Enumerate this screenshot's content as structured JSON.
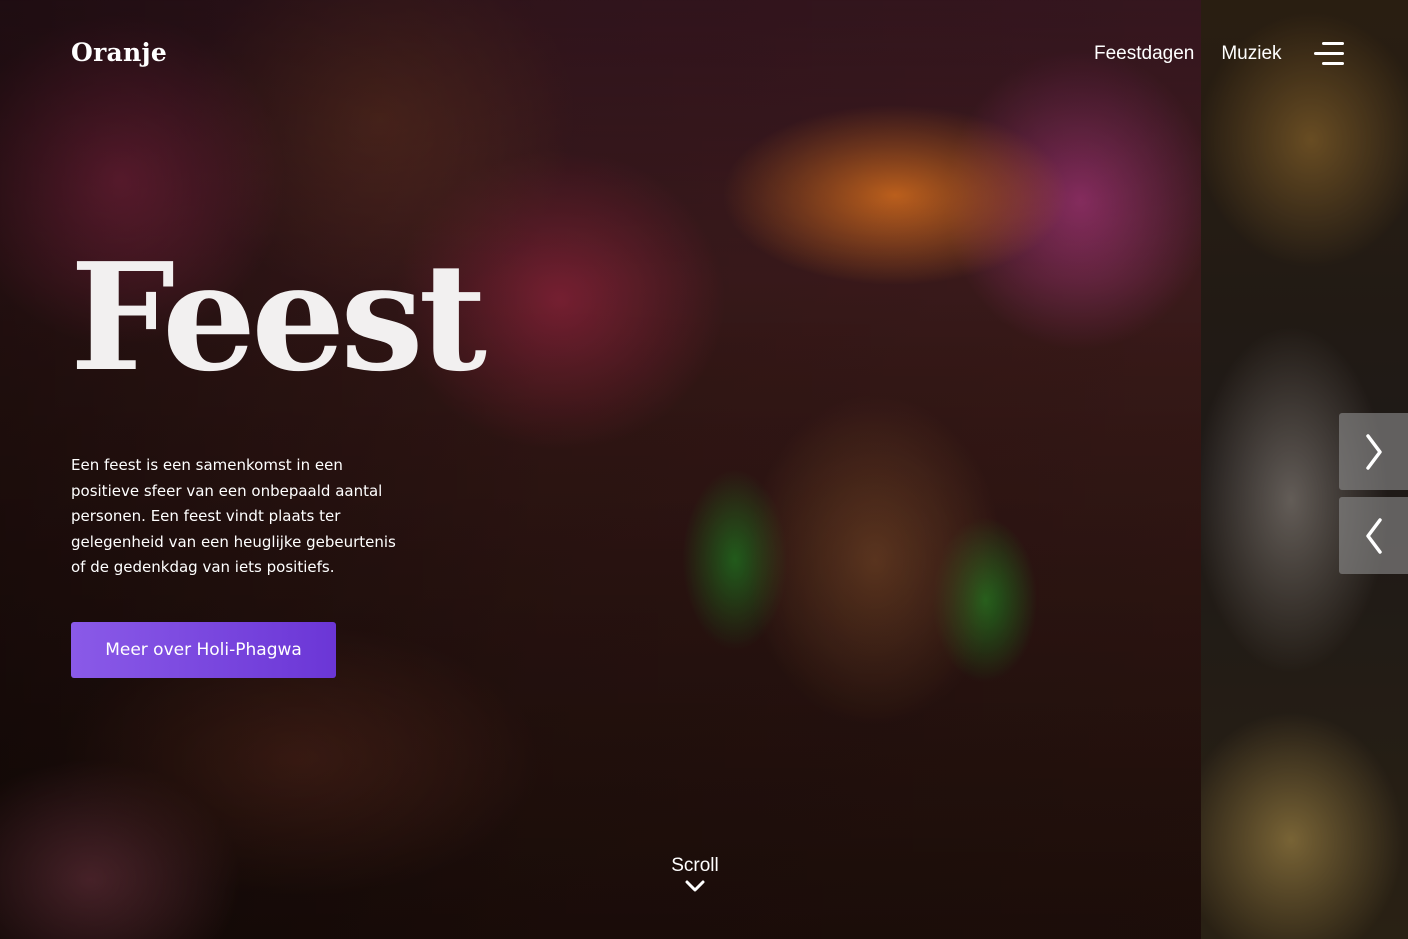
{
  "header": {
    "logo": "Oranje",
    "nav_items": [
      {
        "label": "Feestdagen"
      },
      {
        "label": "Muziek"
      }
    ],
    "menu_icon": "hamburger-menu-icon"
  },
  "hero": {
    "title": "Feest",
    "description": "Een feest is een samenkomst in een positieve sfeer van een onbepaald aantal personen. Een feest vindt plaats ter gelegenheid van een heuglijke gebeurtenis of de gedenkdag van iets positiefs.",
    "cta_label": "Meer over Holi-Phagwa",
    "cta_color": "#7a47e0"
  },
  "slider": {
    "next_icon": "chevron-right-icon",
    "prev_icon": "chevron-left-icon"
  },
  "scroll": {
    "label": "Scroll",
    "icon": "chevron-down-icon"
  }
}
